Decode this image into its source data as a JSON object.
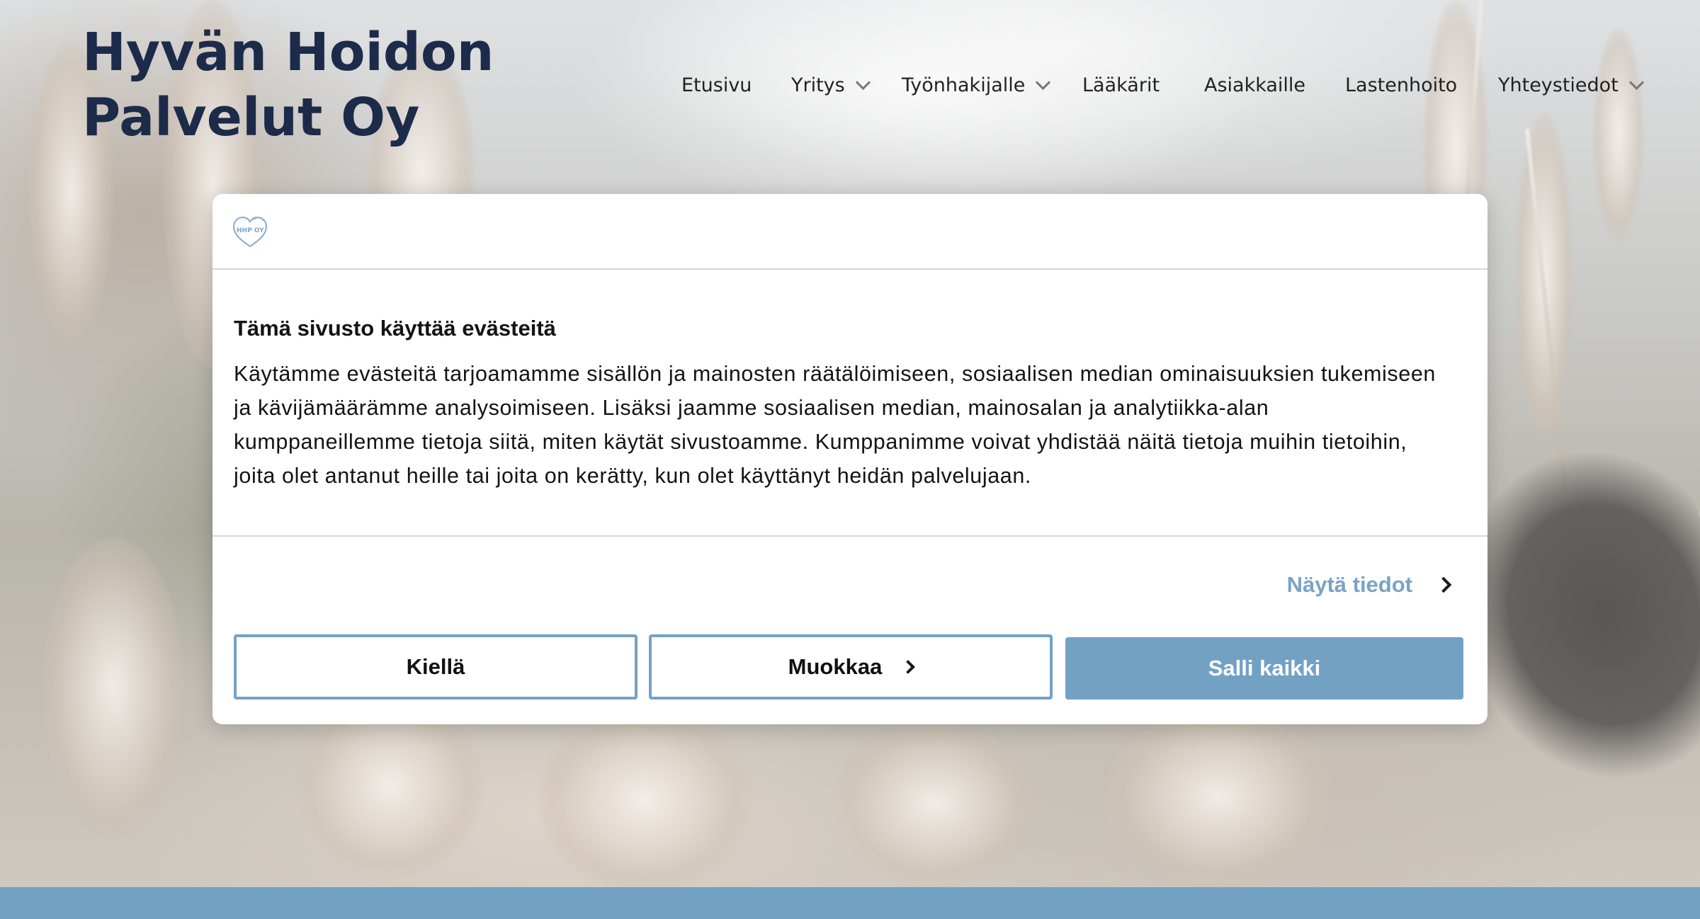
{
  "header": {
    "brand": "Hyvän Hoidon Palvelut Oy",
    "nav": [
      {
        "label": "Etusivu",
        "has_dropdown": false
      },
      {
        "label": "Yritys",
        "has_dropdown": true
      },
      {
        "label": "Työnhakijalle",
        "has_dropdown": true
      },
      {
        "label": "Lääkärit",
        "has_dropdown": false
      },
      {
        "label": "Asiakkaille",
        "has_dropdown": false
      },
      {
        "label": "Lastenhoito",
        "has_dropdown": false
      },
      {
        "label": "Yhteystiedot",
        "has_dropdown": true
      }
    ]
  },
  "cookie_dialog": {
    "logo_text": "HHP OY",
    "title": "Tämä sivusto käyttää evästeitä",
    "body": "Käytämme evästeitä tarjoamamme sisällön ja mainosten räätälöimiseen, sosiaalisen median ominaisuuksien tukemiseen ja kävijämäärämme analysoimiseen. Lisäksi jaamme sosiaalisen median, mainosalan ja analytiikka-alan kumppaneillemme tietoja siitä, miten käytät sivustoamme. Kumppanimme voivat yhdistää näitä tietoja muihin tietoihin, joita olet antanut heille tai joita on kerätty, kun olet käyttänyt heidän palvelujaan.",
    "details_link": "Näytä tiedot",
    "buttons": {
      "deny": "Kiellä",
      "customize": "Muokkaa",
      "allow_all": "Salli kaikki"
    }
  },
  "colors": {
    "accent": "#73a1c4",
    "brand_text": "#1c2b4a",
    "link": "#7aa3c4"
  }
}
